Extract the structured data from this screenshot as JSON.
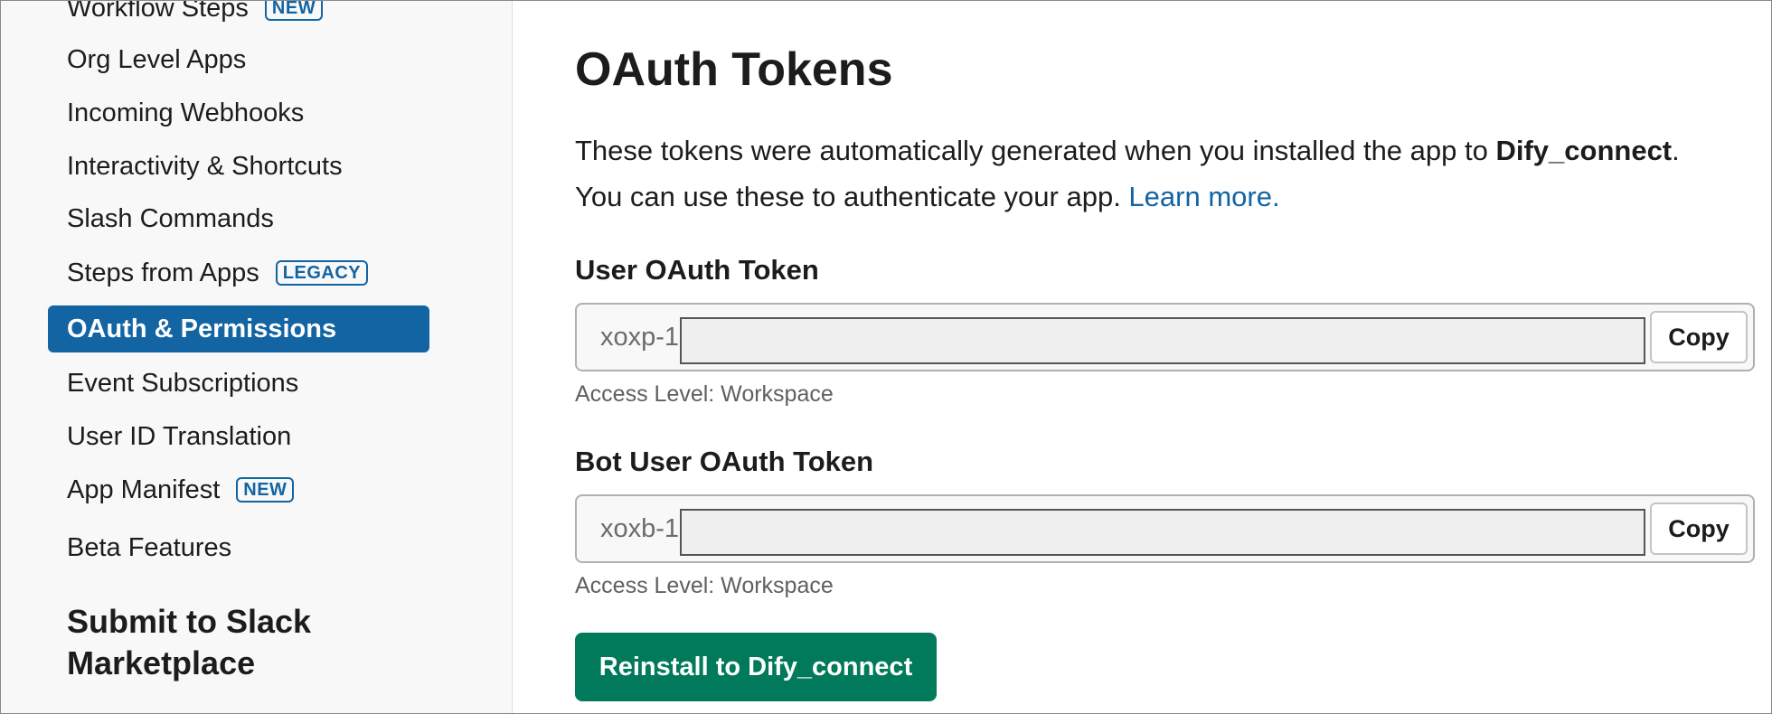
{
  "sidebar": {
    "items": [
      {
        "label": "Workflow Steps",
        "badge": "NEW"
      },
      {
        "label": "Org Level Apps"
      },
      {
        "label": "Incoming Webhooks"
      },
      {
        "label": "Interactivity & Shortcuts"
      },
      {
        "label": "Slash Commands"
      },
      {
        "label": "Steps from Apps",
        "badge": "LEGACY"
      },
      {
        "label": "OAuth & Permissions",
        "active": true
      },
      {
        "label": "Event Subscriptions"
      },
      {
        "label": "User ID Translation"
      },
      {
        "label": "App Manifest",
        "badge": "NEW"
      },
      {
        "label": "Beta Features"
      }
    ],
    "section_title": "Submit to Slack Marketplace"
  },
  "main": {
    "title": "OAuth Tokens",
    "description": {
      "line1_prefix": "These tokens were automatically generated when you installed the app to ",
      "workspace": "Dify_connect",
      "line1_suffix": ".",
      "line2": "You can use these to authenticate your app. ",
      "learn_more": "Learn more."
    },
    "user_token": {
      "label": "User OAuth Token",
      "prefix": "xoxp-1",
      "copy_label": "Copy",
      "access_level": "Access Level: Workspace"
    },
    "bot_token": {
      "label": "Bot User OAuth Token",
      "prefix": "xoxb-1",
      "copy_label": "Copy",
      "access_level": "Access Level: Workspace"
    },
    "reinstall_label": "Reinstall to Dify_connect"
  },
  "colors": {
    "active_nav": "#1264a3",
    "link": "#1264a3",
    "reinstall_button": "#007a5a"
  }
}
